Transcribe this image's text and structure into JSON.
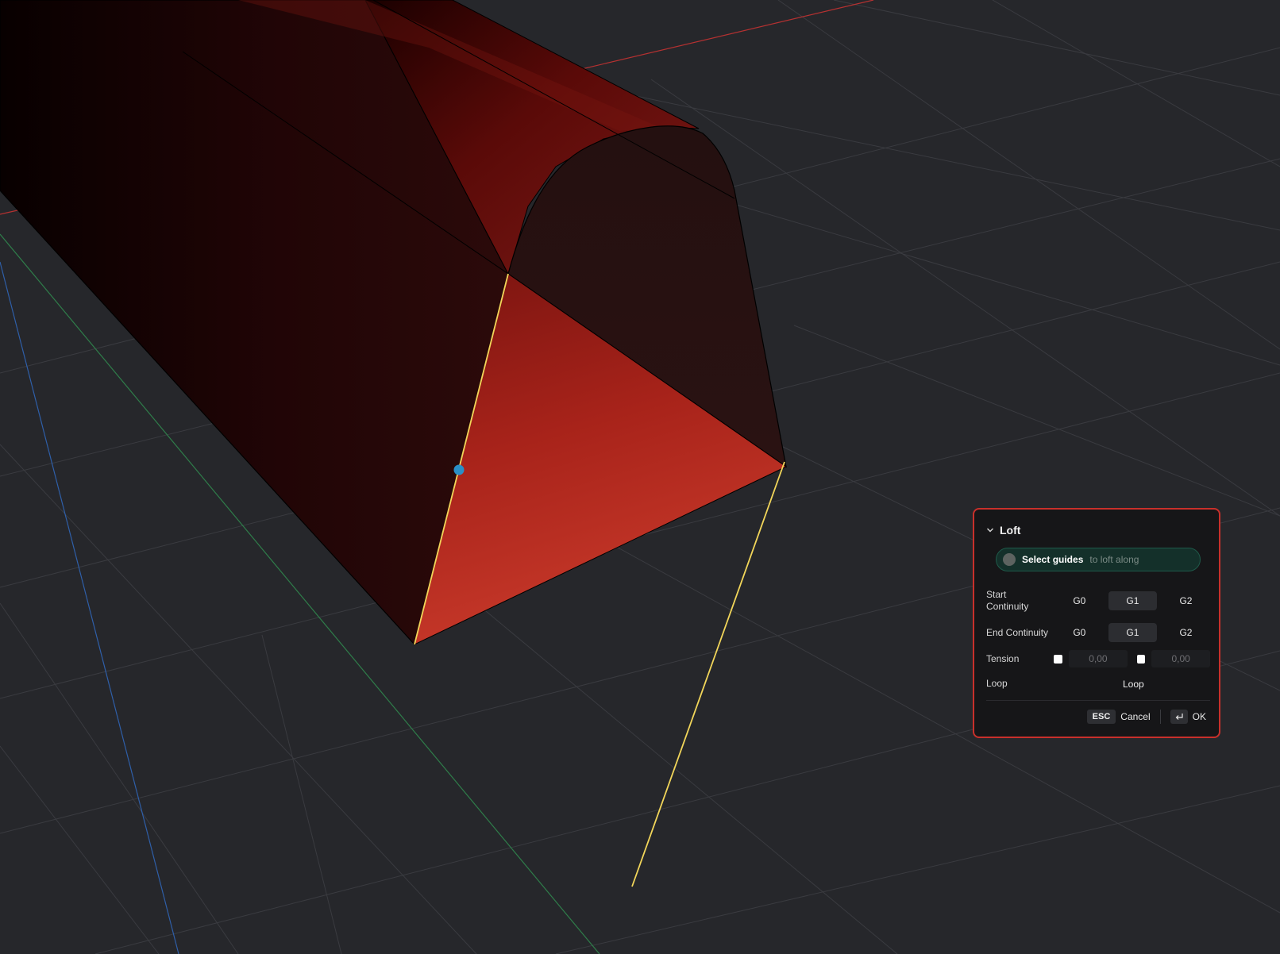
{
  "viewport": {
    "background": "#26272b",
    "grid_color": "#3a3b40",
    "axis_x_color": "#b53131",
    "axis_y_color": "#2f7d4a",
    "axis_z_color": "#2f5fa8",
    "guide_color": "#f2d65a",
    "point_color": "#2a8fc7",
    "solid_color": "#c0301e"
  },
  "loft": {
    "title": "Loft",
    "guides_label": "Select guides",
    "guides_hint": "to loft along",
    "start_continuity_label": "Start Continuity",
    "end_continuity_label": "End Continuity",
    "options": [
      "G0",
      "G1",
      "G2"
    ],
    "start_selected": "G1",
    "end_selected": "G1",
    "tension_label": "Tension",
    "tension_start": "0,00",
    "tension_end": "0,00",
    "loop_label": "Loop",
    "loop_button": "Loop",
    "esc_key": "ESC",
    "cancel_label": "Cancel",
    "ok_label": "OK",
    "accent": "#c8302b"
  }
}
